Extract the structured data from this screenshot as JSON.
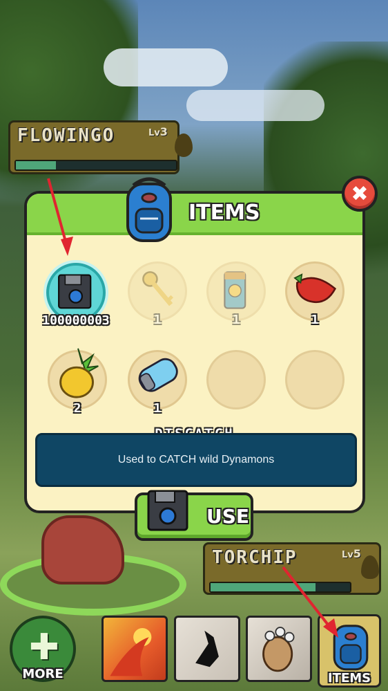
{
  "player_pokemon": {
    "name": "FLOWINGO",
    "level_prefix": "Lv",
    "level": "3",
    "hp_fraction": 0.25,
    "type_icon": "leaf-icon"
  },
  "enemy_pokemon": {
    "name": "TORCHIP",
    "level_prefix": "Lv",
    "level": "5",
    "hp_fraction": 0.75,
    "type_icon": "flame-icon"
  },
  "items_modal": {
    "title": "ITEMS",
    "close_label": "✖",
    "slots": [
      {
        "name": "discatch",
        "qty": "100000003",
        "selected": true,
        "available": true
      },
      {
        "name": "key",
        "qty": "1",
        "available": false
      },
      {
        "name": "plus-one-bar",
        "qty": "1",
        "available": false
      },
      {
        "name": "strawberry",
        "qty": "1",
        "available": true
      },
      {
        "name": "golden-fruit",
        "qty": "2",
        "available": true
      },
      {
        "name": "capsule",
        "qty": "1",
        "available": true
      },
      {
        "name": "empty",
        "qty": ""
      },
      {
        "name": "empty",
        "qty": ""
      }
    ],
    "selected_item_name": "DISCATCH",
    "selected_item_desc": "Used to CATCH wild Dynamons",
    "use_label": "USE"
  },
  "bottom_bar": {
    "more_label": "MORE",
    "items_label": "ITEMS"
  },
  "colors": {
    "accent_green": "#8ad54a",
    "panel": "#fbf2c3",
    "desc_bg": "#0f4664",
    "close_red": "#e64b3c",
    "arrow_red": "#e02530"
  }
}
